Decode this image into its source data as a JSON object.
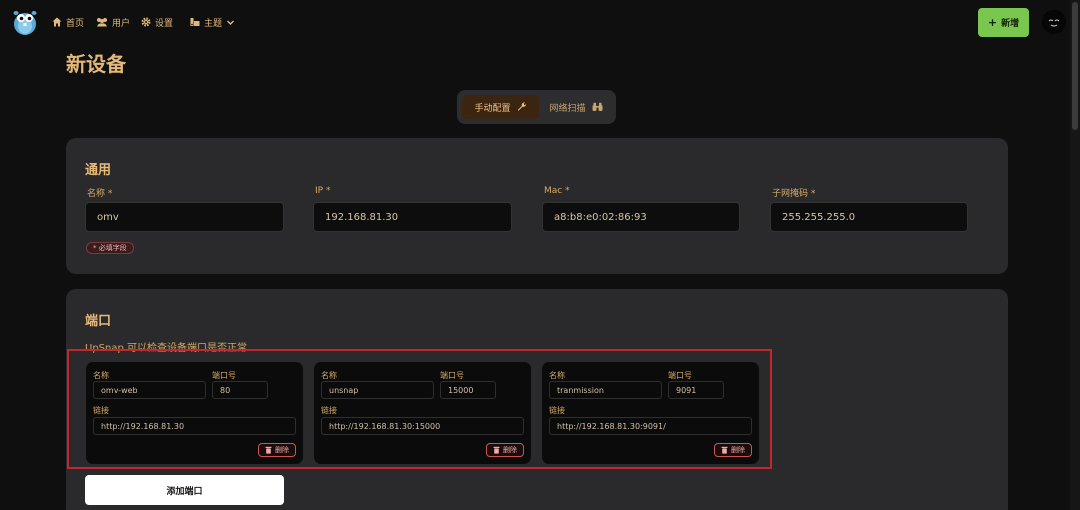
{
  "nav": {
    "home_label": "首页",
    "users_label": "用户",
    "settings_label": "设置",
    "theme_label": "主题",
    "new_button_label": "新增"
  },
  "page": {
    "title": "新设备"
  },
  "tabs": [
    {
      "label": "手动配置",
      "icon": "wrench-icon",
      "active": true
    },
    {
      "label": "网络扫描",
      "icon": "binoculars-icon",
      "active": false
    }
  ],
  "general": {
    "title": "通用",
    "fields": [
      {
        "label": "名称",
        "required_mark": "*",
        "value": "omv"
      },
      {
        "label": "IP",
        "required_mark": "*",
        "value": "192.168.81.30"
      },
      {
        "label": "Mac",
        "required_mark": "*",
        "value": "a8:b8:e0:02:86:93"
      },
      {
        "label": "子网掩码",
        "required_mark": "*",
        "value": "255.255.255.0"
      }
    ],
    "required_note": "* 必填字段"
  },
  "ports": {
    "title": "端口",
    "description": "UpSnap 可以检查设备端口是否正常.",
    "name_label": "名称",
    "port_label": "端口号",
    "link_label": "链接",
    "delete_label": "删除",
    "items": [
      {
        "name": "omv-web",
        "port": "80",
        "link": "http://192.168.81.30"
      },
      {
        "name": "unsnap",
        "port": "15000",
        "link": "http://192.168.81.30:15000"
      },
      {
        "name": "tranmission",
        "port": "9091",
        "link": "http://192.168.81.30:9091/"
      }
    ],
    "add_button_label": "添加端口"
  },
  "colors": {
    "accent": "#e3b878",
    "new_button": "#7ac74f",
    "highlight_border": "#c1272d",
    "card_bg": "#2a2a2c"
  }
}
